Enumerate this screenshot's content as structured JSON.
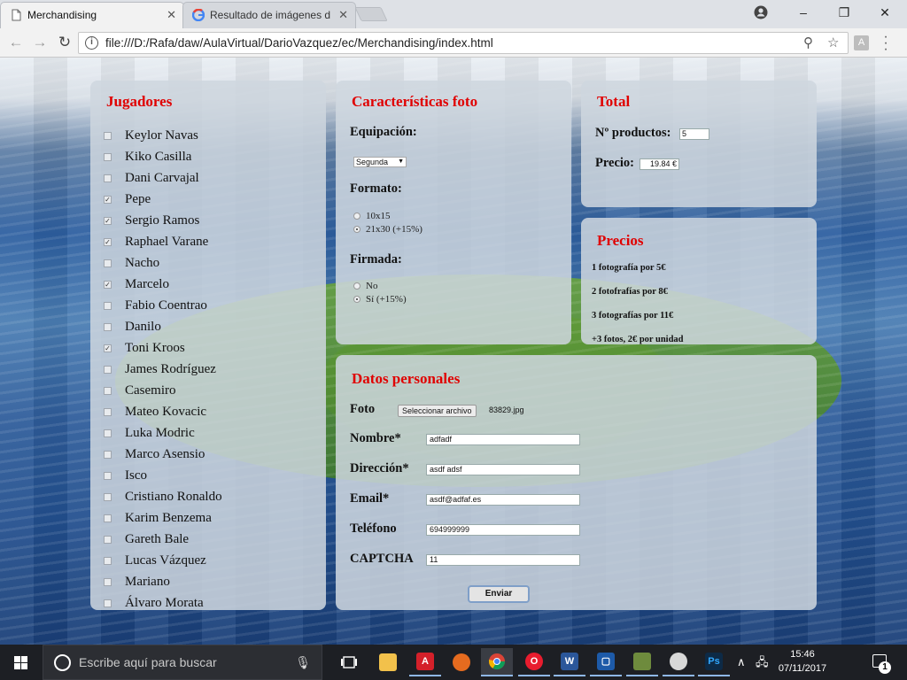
{
  "browser": {
    "tabs": [
      {
        "title": "Merchandising",
        "active": true
      },
      {
        "title": "Resultado de imágenes d",
        "active": false
      }
    ],
    "url": "file:///D:/Rafa/daw/AulaVirtual/DarioVazquez/ec/Merchandising/index.html",
    "pdf_ext": "A"
  },
  "jugadores": {
    "title": "Jugadores",
    "players": [
      {
        "name": "Keylor Navas",
        "checked": false
      },
      {
        "name": "Kiko Casilla",
        "checked": false
      },
      {
        "name": "Dani Carvajal",
        "checked": false
      },
      {
        "name": "Pepe",
        "checked": true
      },
      {
        "name": "Sergio Ramos",
        "checked": true
      },
      {
        "name": "Raphael Varane",
        "checked": true
      },
      {
        "name": "Nacho",
        "checked": false
      },
      {
        "name": "Marcelo",
        "checked": true
      },
      {
        "name": "Fabio Coentrao",
        "checked": false
      },
      {
        "name": "Danilo",
        "checked": false
      },
      {
        "name": "Toni Kroos",
        "checked": true
      },
      {
        "name": "James Rodríguez",
        "checked": false
      },
      {
        "name": "Casemiro",
        "checked": false
      },
      {
        "name": "Mateo Kovacic",
        "checked": false
      },
      {
        "name": "Luka Modric",
        "checked": false
      },
      {
        "name": "Marco Asensio",
        "checked": false
      },
      {
        "name": "Isco",
        "checked": false
      },
      {
        "name": "Cristiano Ronaldo",
        "checked": false
      },
      {
        "name": "Karim Benzema",
        "checked": false
      },
      {
        "name": "Gareth Bale",
        "checked": false
      },
      {
        "name": "Lucas Vázquez",
        "checked": false
      },
      {
        "name": "Mariano",
        "checked": false
      },
      {
        "name": "Álvaro Morata",
        "checked": false
      }
    ]
  },
  "caracteristicas": {
    "title": "Características foto",
    "equipacion_label": "Equipación:",
    "equipacion_value": "Segunda",
    "formato_label": "Formato:",
    "formato_options": [
      {
        "label": "10x15",
        "selected": false
      },
      {
        "label": "21x30 (+15%)",
        "selected": true
      }
    ],
    "firmada_label": "Firmada:",
    "firmada_options": [
      {
        "label": "No",
        "selected": false
      },
      {
        "label": "Sí (+15%)",
        "selected": true
      }
    ]
  },
  "total": {
    "title": "Total",
    "productos_label": "Nº productos:",
    "productos_value": "5",
    "precio_label": "Precio:",
    "precio_value": "19.84 €"
  },
  "precios": {
    "title": "Precios",
    "lines": [
      "1 fotografía por 5€",
      "2 fotofrafías por 8€",
      "3 fotografías por 11€",
      "+3 fotos, 2€ por unidad"
    ]
  },
  "datos": {
    "title": "Datos personales",
    "foto_label": "Foto",
    "file_button": "Seleccionar archivo",
    "file_name": "83829.jpg",
    "nombre_label": "Nombre*",
    "nombre_value": "adfadf",
    "direccion_label": "Dirección*",
    "direccion_value": "asdf adsf",
    "email_label": "Email*",
    "email_value": "asdf@adfaf.es",
    "telefono_label": "Teléfono",
    "telefono_value": "694999999",
    "captcha_label": "CAPTCHA",
    "captcha_value": "11",
    "submit_label": "Enviar"
  },
  "taskbar": {
    "search_placeholder": "Escribe aquí para buscar",
    "time": "15:46",
    "date": "07/11/2017",
    "notifications": "1"
  }
}
